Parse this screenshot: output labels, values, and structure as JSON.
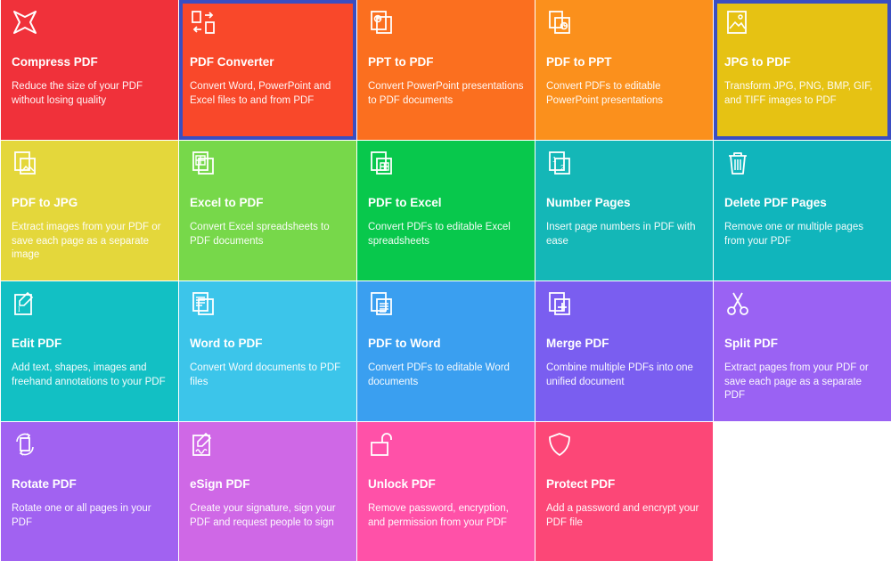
{
  "tools": [
    {
      "id": "compress",
      "title": "Compress PDF",
      "desc": "Reduce the size of your PDF without losing quality",
      "color": "#f0313a",
      "icon": "compress-icon"
    },
    {
      "id": "converter",
      "title": "PDF Converter",
      "desc": "Convert Word, PowerPoint and Excel files to and from PDF",
      "color": "#f9482a",
      "icon": "convert-arrows-icon",
      "selected": true
    },
    {
      "id": "ppt-to-pdf",
      "title": "PPT to PDF",
      "desc": "Convert PowerPoint presentations to PDF documents",
      "color": "#fb6f1f",
      "icon": "ppt-file-icon"
    },
    {
      "id": "pdf-to-ppt",
      "title": "PDF to PPT",
      "desc": "Convert PDFs to editable PowerPoint presentations",
      "color": "#fb901c",
      "icon": "pdf-ppt-file-icon"
    },
    {
      "id": "jpg-to-pdf",
      "title": "JPG to PDF",
      "desc": "Transform JPG, PNG, BMP, GIF, and TIFF images to PDF",
      "color": "#e6c213",
      "icon": "image-file-icon",
      "selected": true
    },
    {
      "id": "pdf-to-jpg",
      "title": "PDF to JPG",
      "desc": "Extract images from your PDF or save each page as a separate image",
      "color": "#e4d73b",
      "icon": "pdf-image-icon"
    },
    {
      "id": "excel-to-pdf",
      "title": "Excel to PDF",
      "desc": "Convert Excel spreadsheets to PDF documents",
      "color": "#77d84a",
      "icon": "spreadsheet-file-icon"
    },
    {
      "id": "pdf-to-excel",
      "title": "PDF to Excel",
      "desc": "Convert PDFs to editable Excel spreadsheets",
      "color": "#08c84c",
      "icon": "pdf-spreadsheet-icon"
    },
    {
      "id": "number-pages",
      "title": "Number Pages",
      "desc": "Insert page numbers in PDF with ease",
      "color": "#14b7b7",
      "icon": "number-pages-icon"
    },
    {
      "id": "delete-pages",
      "title": "Delete PDF Pages",
      "desc": "Remove one or multiple pages from your PDF",
      "color": "#10b5bc",
      "icon": "trash-icon"
    },
    {
      "id": "edit-pdf",
      "title": "Edit PDF",
      "desc": "Add text, shapes, images and freehand annotations to your PDF",
      "color": "#12c0c4",
      "icon": "edit-file-icon"
    },
    {
      "id": "word-to-pdf",
      "title": "Word to PDF",
      "desc": "Convert Word documents to PDF files",
      "color": "#3cc5ea",
      "icon": "word-file-icon"
    },
    {
      "id": "pdf-to-word",
      "title": "PDF to Word",
      "desc": "Convert PDFs to editable Word documents",
      "color": "#3a9ff0",
      "icon": "pdf-word-icon"
    },
    {
      "id": "merge-pdf",
      "title": "Merge PDF",
      "desc": "Combine multiple PDFs into one unified document",
      "color": "#7a5ef0",
      "icon": "merge-files-icon"
    },
    {
      "id": "split-pdf",
      "title": "Split PDF",
      "desc": "Extract pages from your PDF or save each page as a separate PDF",
      "color": "#9a62f3",
      "icon": "scissors-icon"
    },
    {
      "id": "rotate-pdf",
      "title": "Rotate PDF",
      "desc": "Rotate one or all pages in your PDF",
      "color": "#a162f1",
      "icon": "rotate-icon"
    },
    {
      "id": "esign-pdf",
      "title": "eSign PDF",
      "desc": "Create your signature, sign your PDF and request people to sign",
      "color": "#cf68e6",
      "icon": "signature-icon"
    },
    {
      "id": "unlock-pdf",
      "title": "Unlock PDF",
      "desc": "Remove password, encryption, and permission from your PDF",
      "color": "#ff51a8",
      "icon": "unlock-icon"
    },
    {
      "id": "protect-pdf",
      "title": "Protect PDF",
      "desc": "Add a password and encrypt your PDF file",
      "color": "#fc4777",
      "icon": "shield-icon"
    }
  ]
}
